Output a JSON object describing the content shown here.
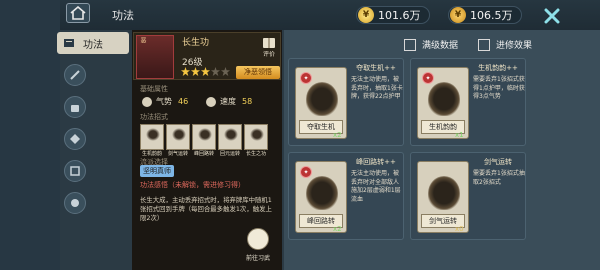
{
  "header": {
    "title": "功法"
  },
  "currency": [
    {
      "icon": "copper-coin-icon",
      "value": "101.6万"
    },
    {
      "icon": "gold-coin-icon",
      "value": "106.5万"
    }
  ],
  "sidebar": {
    "active_tab": "功法"
  },
  "hero": {
    "badge": "恶",
    "name": "长生功",
    "level": "26级",
    "stars": 5,
    "filled_stars": 3,
    "upgrade_label": "净恶领悟",
    "book_label": "评价"
  },
  "sections": {
    "base_attr": "基础属性",
    "skills": "功法招式",
    "feature": "流派选择",
    "effect": "功法感悟"
  },
  "stats": [
    {
      "label": "气势",
      "value": "46"
    },
    {
      "label": "速度",
      "value": "58"
    }
  ],
  "skill_icons": [
    "生机韵韵",
    "剑气运转",
    "峰回路转",
    "回元运转",
    "长生之功"
  ],
  "style_chip": "坚明真师",
  "effect_status": "功法感悟（未解锁，需进修习得）",
  "effect_desc": "长生大成，主动丢弃招式时，将弃牌库中随机1张招式回到手牌（每回合最多触发1次，触发上限2次）",
  "learn_label": "前往习武",
  "options": {
    "full_data": "满级数据",
    "advanced_effect": "进修效果"
  },
  "cards": [
    {
      "name": "夺取生机++",
      "label": "夺取生机",
      "count": "x2",
      "desc": "无法主动使用，被丢弃时，抽取1张卡牌，获得22点护甲"
    },
    {
      "name": "生机韵韵++",
      "label": "生机韵韵",
      "count": "x1",
      "desc": "需要丢弃1张招式获得1点护甲，临时获得3点气势"
    },
    {
      "name": "峰回路转++",
      "label": "峰回路转",
      "count": "x2",
      "desc": "无法主动使用，被丢弃时对全部敌人施加2层虚弱和1层流血"
    },
    {
      "name": "剑气运转",
      "label": "剑气运转",
      "count": "x0",
      "desc": "需要丢弃1张招式抽取2张招式"
    }
  ]
}
